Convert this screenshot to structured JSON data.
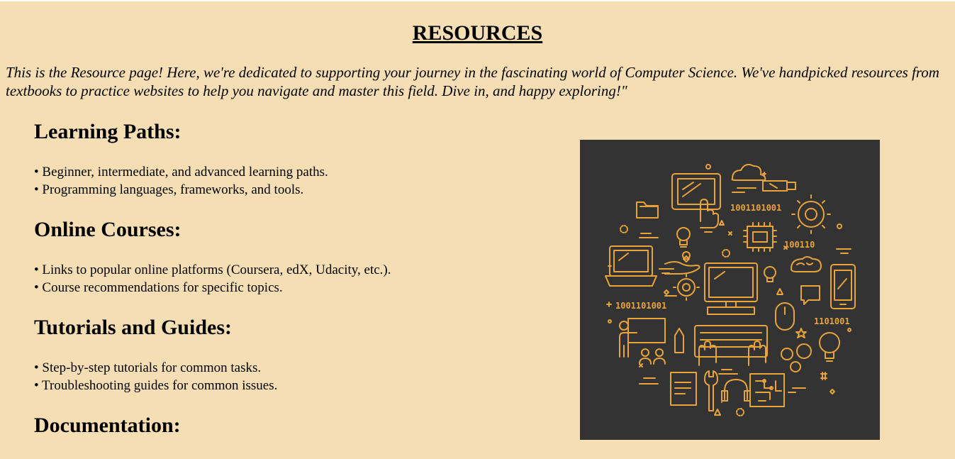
{
  "colors": {
    "background": "#f5deb3",
    "illustration_bg": "#333333",
    "illustration_stroke": "#e8a33a"
  },
  "page": {
    "title": "RESOURCES",
    "intro": "This is the Resource page! Here, we're dedicated to supporting your journey in the fascinating world of Computer Science. We've handpicked resources from textbooks to practice websites to help you navigate and master this field. Dive in, and happy exploring!\""
  },
  "sections": [
    {
      "heading": "Learning Paths:",
      "items": [
        "• Beginner, intermediate, and advanced learning paths.",
        "• Programming languages, frameworks, and tools."
      ]
    },
    {
      "heading": "Online Courses:",
      "items": [
        "• Links to popular online platforms (Coursera, edX, Udacity, etc.).",
        "• Course recommendations for specific topics."
      ]
    },
    {
      "heading": "Tutorials and Guides:",
      "items": [
        "• Step-by-step tutorials for common tasks.",
        "• Troubleshooting guides for common issues."
      ]
    },
    {
      "heading": "Documentation:",
      "items": []
    }
  ],
  "illustration": {
    "icons": [
      "tablet-touch-icon",
      "cloud-icon",
      "usb-stick-icon",
      "folder-icon",
      "gear-icon",
      "lightbulb-icon",
      "chip-icon",
      "laptop-icon",
      "hand-icon",
      "monitor-icon",
      "brain-icon",
      "smartphone-icon",
      "chat-icon",
      "mouse-icon",
      "presenter-icon",
      "pencil-icon",
      "keyboard-hands-icon",
      "gears-icon",
      "book-icon",
      "wrench-icon",
      "headset-icon",
      "circuit-icon"
    ],
    "binary_texts": [
      "1001101001",
      "100110",
      "1001101001",
      "1101001"
    ]
  }
}
